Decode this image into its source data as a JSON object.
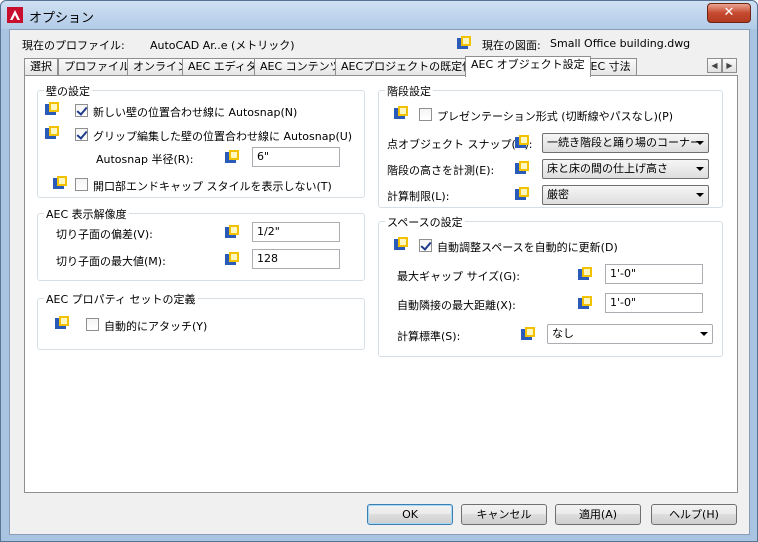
{
  "window": {
    "title": "オプション",
    "close_glyph": "✕"
  },
  "profile": {
    "label": "現在のプロファイル:",
    "value": "AutoCAD Ar..e (メトリック)"
  },
  "drawing": {
    "label": "現在の図面:",
    "value": "Small Office building.dwg"
  },
  "tabs": [
    "選択",
    "プロファイル",
    "オンライン",
    "AEC エディタ",
    "AEC コンテンツ",
    "AECプロジェクトの既定値",
    "AEC オブジェクト設定",
    "AEC 寸法"
  ],
  "active_tab": "AEC オブジェクト設定",
  "wall": {
    "title": "壁の設定",
    "snap_new": "新しい壁の位置合わせ線に Autosnap(N)",
    "snap_grip": "グリップ編集した壁の位置合わせ線に Autosnap(U)",
    "radius_label": "Autosnap 半径(R):",
    "radius_value": "6\"",
    "endcap": "開口部エンドキャップ スタイルを表示しない(T)"
  },
  "resolution": {
    "title": "AEC 表示解像度",
    "deviation_label": "切り子面の偏差(V):",
    "deviation_value": "1/2\"",
    "max_label": "切り子面の最大値(M):",
    "max_value": "128"
  },
  "propset": {
    "title": "AEC プロパティ セットの定義",
    "auto_attach": "自動的にアタッチ(Y)"
  },
  "stair": {
    "title": "階段設定",
    "presentation": "プレゼンテーション形式 (切断線やパスなし)(P)",
    "snap_label": "点オブジェクト スナップ(O):",
    "snap_value": "一続き階段と踊り場のコーナー",
    "height_label": "階段の高さを計測(E):",
    "height_value": "床と床の間の仕上げ高さ",
    "limit_label": "計算制限(L):",
    "limit_value": "厳密"
  },
  "space": {
    "title": "スペースの設定",
    "auto_update": "自動調整スペースを自動的に更新(D)",
    "gap_label": "最大ギャップ サイズ(G):",
    "gap_value": "1'-0\"",
    "adjacency_label": "自動隣接の最大距離(X):",
    "adjacency_value": "1'-0\"",
    "standard_label": "計算標準(S):",
    "standard_value": "なし"
  },
  "buttons": {
    "ok": "OK",
    "cancel": "キャンセル",
    "apply": "適用(A)",
    "help": "ヘルプ(H)"
  },
  "colors": {
    "accent": "#3c7fb1",
    "titlebar": "#b2cbe7",
    "close": "#c64a2f"
  }
}
